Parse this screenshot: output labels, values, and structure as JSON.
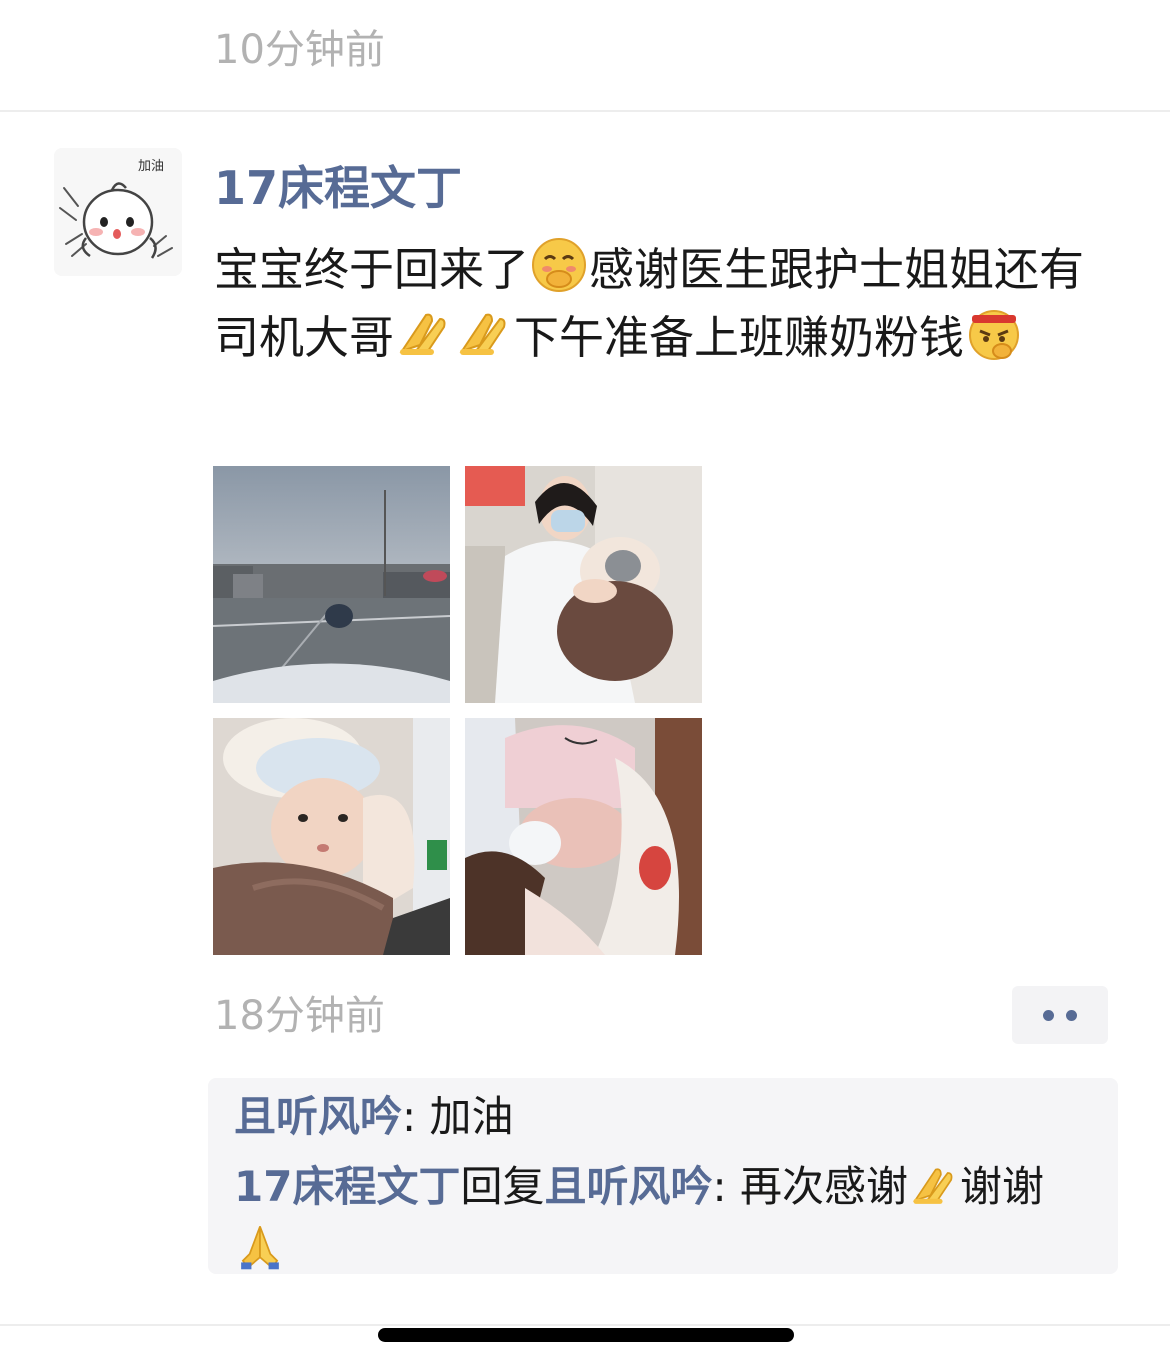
{
  "previous_post": {
    "time": "10分钟前"
  },
  "post": {
    "author": "17床程文丁",
    "avatar_text": "加油",
    "text_segments": [
      {
        "t": "宝宝终于回来了"
      },
      {
        "icon": "shy-face-emoji"
      },
      {
        "t": "感谢医生跟护士姐姐还有司机大哥"
      },
      {
        "icon": "clasped-hands-emoji"
      },
      {
        "icon": "clasped-hands-emoji"
      },
      {
        "t": "下午准备上班赚奶粉钱"
      },
      {
        "icon": "determined-face-emoji"
      }
    ],
    "photos": [
      {
        "name": "photo-street-rainy-view"
      },
      {
        "name": "photo-nurse-holding-baby"
      },
      {
        "name": "photo-baby-in-blanket"
      },
      {
        "name": "photo-baby-pink-hat"
      }
    ],
    "time": "18分钟前",
    "more_button_icon": "more-dots-icon"
  },
  "comments": [
    {
      "author": "且听风吟",
      "separator": ": ",
      "text": "加油"
    },
    {
      "author": "17床程文丁",
      "reply_word": "回复",
      "reply_to": "且听风吟",
      "separator": ": ",
      "text_before": "再次感谢",
      "text_after": "谢谢",
      "icons": [
        "clasped-hands-emoji",
        "praying-hands-emoji"
      ]
    }
  ],
  "colors": {
    "link": "#576b95",
    "text": "#191919",
    "muted": "#b2b2b2",
    "comment_bg": "#f5f5f7"
  }
}
